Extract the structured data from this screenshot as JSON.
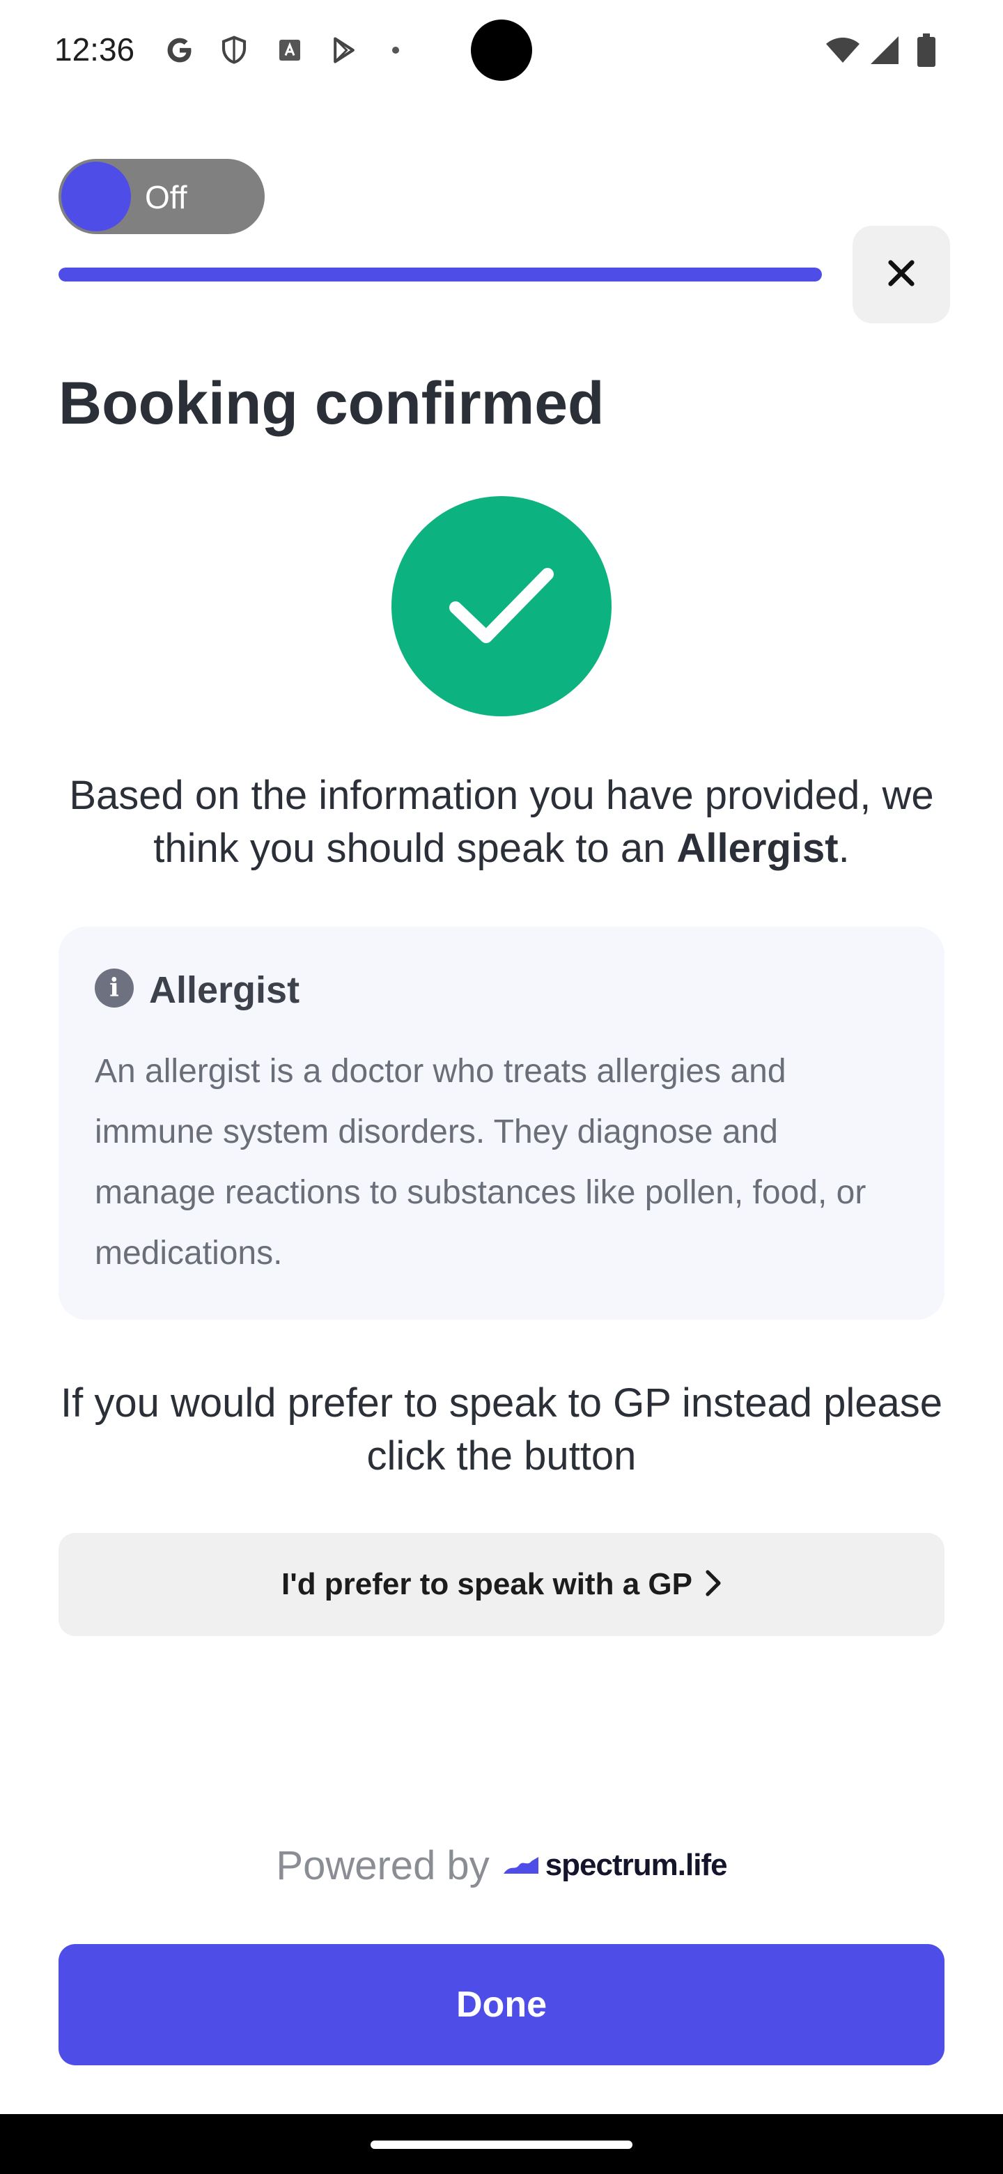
{
  "status_bar": {
    "time": "12:36",
    "left_icons": [
      "google-icon",
      "shield-icon",
      "text-a-icon",
      "play-store-icon",
      "dot-icon"
    ],
    "right_icons": [
      "wifi-icon",
      "signal-icon",
      "battery-icon"
    ]
  },
  "toggle": {
    "label": "Off",
    "state": "off"
  },
  "progress": {
    "fraction": 1.0
  },
  "header": {
    "close_icon": "close-icon"
  },
  "title": "Booking confirmed",
  "recommendation": {
    "prefix": "Based on the information you have provided, we think you should speak to an ",
    "specialist": "Allergist",
    "suffix": "."
  },
  "info_card": {
    "icon": "info-icon",
    "title": "Allergist",
    "body": "An allergist is a doctor who treats allergies and immune system disorders. They diagnose and manage reactions to substances like pollen, food, or medications."
  },
  "gp_prompt": "If you would prefer to speak to GP instead please click the button",
  "gp_button": {
    "label": "I'd prefer to speak with a GP"
  },
  "powered_by": {
    "text": "Powered by",
    "brand": "spectrum.life"
  },
  "done_button": {
    "label": "Done"
  },
  "colors": {
    "accent": "#4f4de8",
    "success": "#0cb27f",
    "card_bg": "#f5f7fc"
  }
}
